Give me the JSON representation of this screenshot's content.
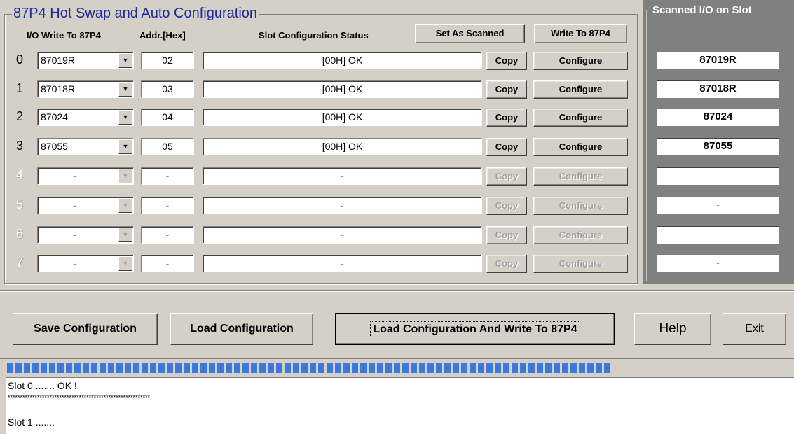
{
  "group": {
    "title": "87P4 Hot Swap and Auto Configuration",
    "col_io": "I/O Write To 87P4",
    "col_addr": "Addr.[Hex]",
    "col_status": "Slot Configuration Status",
    "set_scanned": "Set As Scanned",
    "write_to": "Write To 87P4"
  },
  "scanned": {
    "title": "Scanned I/O on Slot"
  },
  "rows": [
    {
      "num": "0",
      "module": "87019R",
      "addr": "02",
      "status": "[00H] OK",
      "copy": "Copy",
      "configure": "Configure",
      "scanned": "87019R"
    },
    {
      "num": "1",
      "module": "87018R",
      "addr": "03",
      "status": "[00H] OK",
      "copy": "Copy",
      "configure": "Configure",
      "scanned": "87018R"
    },
    {
      "num": "2",
      "module": "87024",
      "addr": "04",
      "status": "[00H] OK",
      "copy": "Copy",
      "configure": "Configure",
      "scanned": "87024"
    },
    {
      "num": "3",
      "module": "87055",
      "addr": "05",
      "status": "[00H] OK",
      "copy": "Copy",
      "configure": "Configure",
      "scanned": "87055"
    },
    {
      "num": "4",
      "module": "-",
      "addr": "-",
      "status": "-",
      "copy": "Copy",
      "configure": "Configure",
      "scanned": "-"
    },
    {
      "num": "5",
      "module": "-",
      "addr": "-",
      "status": "-",
      "copy": "Copy",
      "configure": "Configure",
      "scanned": "-"
    },
    {
      "num": "6",
      "module": "-",
      "addr": "-",
      "status": "-",
      "copy": "Copy",
      "configure": "Configure",
      "scanned": "-"
    },
    {
      "num": "7",
      "module": "-",
      "addr": "-",
      "status": "-",
      "copy": "Copy",
      "configure": "Configure",
      "scanned": "-"
    }
  ],
  "buttons": {
    "save": "Save Configuration",
    "load": "Load Configuration",
    "load_write": "Load  Configuration And Write To 87P4",
    "help": "Help",
    "exit": "Exit"
  },
  "progress": {
    "fraction": 0.78
  },
  "log": {
    "line1": "Slot 0 ....... OK !",
    "line2": "**********************************************************",
    "line3": "Slot 1 ......."
  }
}
